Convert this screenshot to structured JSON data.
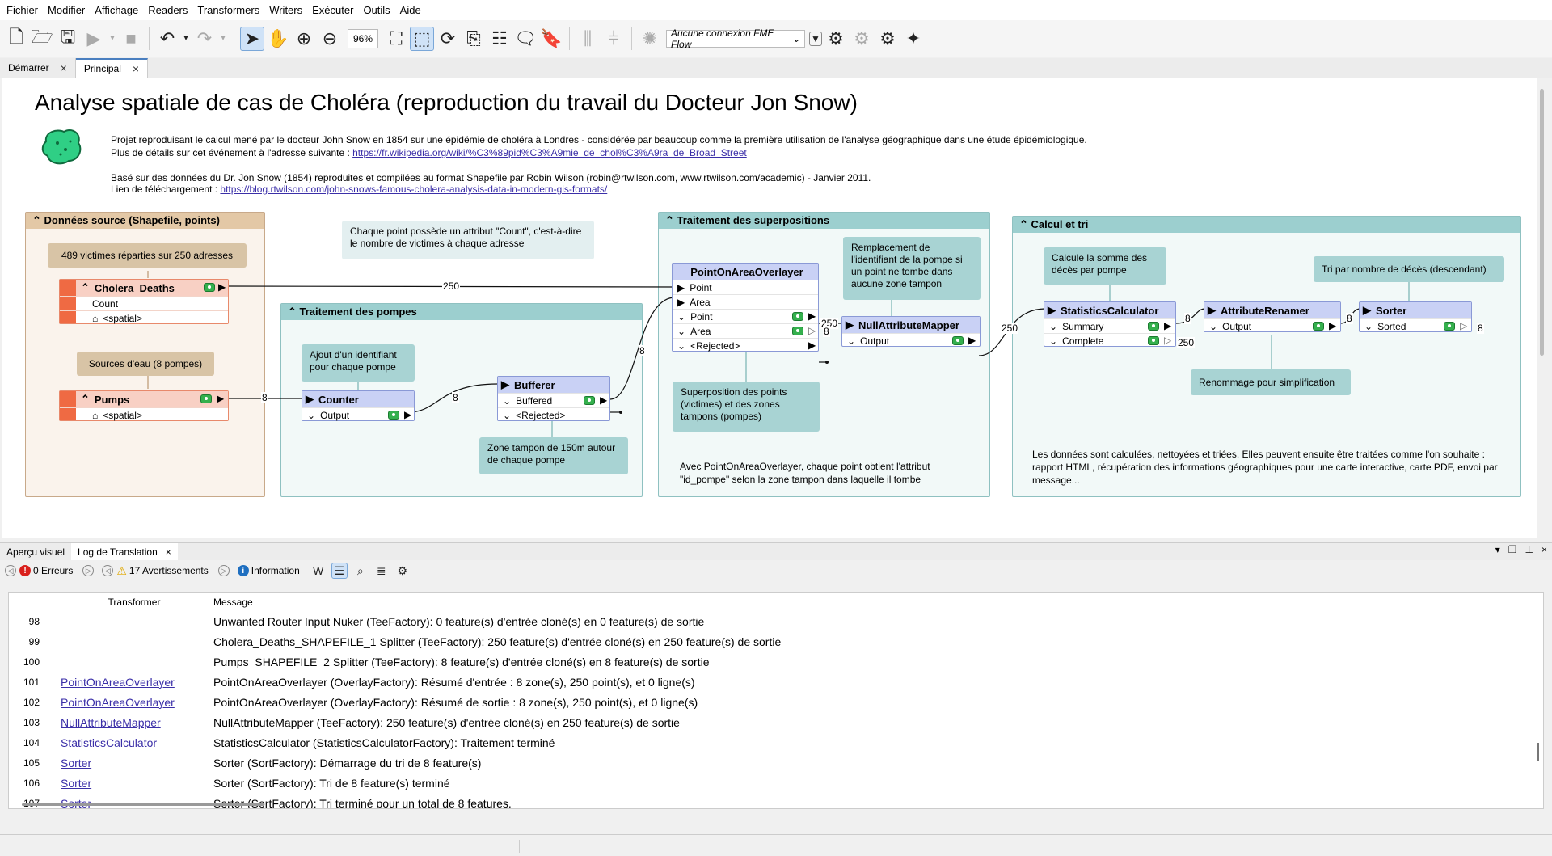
{
  "menu": [
    "Fichier",
    "Modifier",
    "Affichage",
    "Readers",
    "Transformers",
    "Writers",
    "Exécuter",
    "Outils",
    "Aide"
  ],
  "toolbar": {
    "zoom": "96%",
    "connection": "Aucune connexion FME Flow"
  },
  "tabs": [
    {
      "label": "Démarrer"
    },
    {
      "label": "Principal"
    }
  ],
  "canvas": {
    "title": "Analyse spatiale de cas de Choléra (reproduction du travail du Docteur Jon Snow)",
    "desc1": "Projet reproduisant le calcul mené par le docteur John Snow en 1854 sur une épidémie de choléra à Londres - considérée par beaucoup comme la première utilisation de l'analyse géographique dans une étude épidémiologique.",
    "desc2_prefix": "Plus de détails sur cet événement à l'adresse suivante : ",
    "desc2_link": "https://fr.wikipedia.org/wiki/%C3%89pid%C3%A9mie_de_chol%C3%A9ra_de_Broad_Street",
    "desc3": "Basé sur des données du Dr. Jon Snow (1854) reproduites et compilées au format Shapefile par Robin Wilson (robin@rtwilson.com, www.rtwilson.com/academic) - Janvier 2011.",
    "desc4_prefix": "Lien de téléchargement : ",
    "desc4_link": "https://blog.rtwilson.com/john-snows-famous-cholera-analysis-data-in-modern-gis-formats/",
    "bookmarks": {
      "source": "Données source (Shapefile, points)",
      "pumps": "Traitement des pompes",
      "overlay": "Traitement des superpositions",
      "calc": "Calcul et tri"
    },
    "notes": {
      "victims": "489 victimes réparties sur 250 adresses",
      "water": "Sources d'eau (8 pompes)",
      "count_attr": "Chaque point possède un attribut \"Count\", c'est-à-dire le nombre de victimes à chaque adresse",
      "add_id": "Ajout d'un identifiant pour chaque pompe",
      "buffer": "Zone tampon de 150m autour de chaque pompe",
      "replace": "Remplacement de l'identifiant de la pompe si un point ne tombe dans aucune zone tampon",
      "overlay": "Superposition des points (victimes) et des zones tampons (pompes)",
      "overlay_result": "Avec PointOnAreaOverlayer, chaque point obtient l'attribut \"id_pompe\" selon la zone tampon dans laquelle il tombe",
      "sum": "Calcule la somme des décès par pompe",
      "sort": "Tri par nombre de décès (descendant)",
      "rename": "Renommage pour simplification",
      "final": "Les données sont calculées, nettoyées et triées. Elles peuvent ensuite être traitées comme l'on souhaite : rapport HTML, récupération des informations géographiques pour une carte interactive, carte PDF, envoi par message..."
    },
    "transformers": {
      "cholera": {
        "name": "Cholera_Deaths",
        "attr1": "Count",
        "attr2": "<spatial>"
      },
      "pumps": {
        "name": "Pumps",
        "attr1": "<spatial>"
      },
      "counter": {
        "name": "Counter",
        "port1": "Output"
      },
      "bufferer": {
        "name": "Bufferer",
        "port1": "Buffered",
        "port2": "<Rejected>"
      },
      "poao": {
        "name": "PointOnAreaOverlayer",
        "in1": "Point",
        "in2": "Area",
        "out1": "Point",
        "out2": "Area",
        "out3": "<Rejected>"
      },
      "nam": {
        "name": "NullAttributeMapper",
        "port1": "Output"
      },
      "stats": {
        "name": "StatisticsCalculator",
        "port1": "Summary",
        "port2": "Complete"
      },
      "renamer": {
        "name": "AttributeRenamer",
        "port1": "Output"
      },
      "sorter": {
        "name": "Sorter",
        "port1": "Sorted"
      }
    },
    "counts": {
      "c1": "250",
      "c2": "8",
      "c3": "8",
      "c4": "8",
      "c5": "250",
      "c6": "8",
      "c7": "250",
      "c8": "8",
      "c9": "250",
      "c10": "8",
      "c11": "8"
    }
  },
  "bottom_tabs": [
    {
      "label": "Aperçu visuel"
    },
    {
      "label": "Log de Translation"
    }
  ],
  "log_toolbar": {
    "errors": "0 Erreurs",
    "warnings": "17 Avertissements",
    "info": "Information"
  },
  "log": {
    "headers": {
      "transformer": "Transformer",
      "message": "Message"
    },
    "rows": [
      {
        "num": "98",
        "tf": "",
        "msg": "Unwanted Router Input Nuker (TeeFactory): 0 feature(s) d'entrée cloné(s) en 0 feature(s) de sortie"
      },
      {
        "num": "99",
        "tf": "",
        "msg": "Cholera_Deaths_SHAPEFILE_1 Splitter (TeeFactory): 250 feature(s) d'entrée cloné(s) en 250 feature(s) de sortie"
      },
      {
        "num": "100",
        "tf": "",
        "msg": "Pumps_SHAPEFILE_2 Splitter (TeeFactory): 8 feature(s) d'entrée cloné(s) en 8 feature(s) de sortie"
      },
      {
        "num": "101",
        "tf": "PointOnAreaOverlayer",
        "msg": "PointOnAreaOverlayer (OverlayFactory): Résumé d'entrée : 8 zone(s), 250 point(s), et 0 ligne(s)"
      },
      {
        "num": "102",
        "tf": "PointOnAreaOverlayer",
        "msg": "PointOnAreaOverlayer (OverlayFactory): Résumé de sortie : 8 zone(s), 250 point(s), et 0 ligne(s)"
      },
      {
        "num": "103",
        "tf": "NullAttributeMapper",
        "msg": "NullAttributeMapper (TeeFactory): 250 feature(s) d'entrée cloné(s) en 250 feature(s) de sortie"
      },
      {
        "num": "104",
        "tf": "StatisticsCalculator",
        "msg": "StatisticsCalculator (StatisticsCalculatorFactory): Traitement terminé"
      },
      {
        "num": "105",
        "tf": "Sorter",
        "msg": "Sorter (SortFactory): Démarrage du tri de 8 feature(s)"
      },
      {
        "num": "106",
        "tf": "Sorter",
        "msg": "Sorter (SortFactory): Tri de 8 feature(s) terminé"
      },
      {
        "num": "107",
        "tf": "Sorter",
        "msg": "Sorter (SortFactory): Tri terminé pour un total de 8 features."
      }
    ]
  }
}
